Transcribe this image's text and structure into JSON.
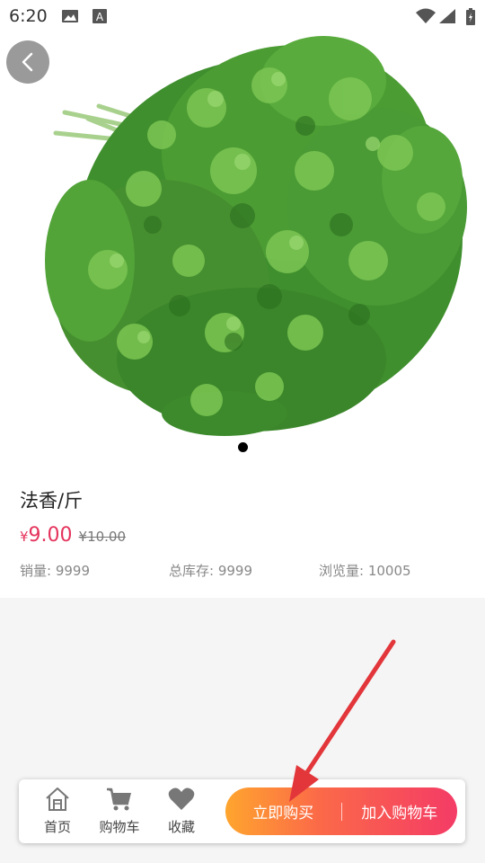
{
  "status_bar": {
    "time": "6:20"
  },
  "product": {
    "title": "法香/斤",
    "price_symbol": "¥",
    "price": "9.00",
    "original_price": "¥10.00",
    "sales": "销量: 9999",
    "stock": "总库存: 9999",
    "views": "浏览量: 10005"
  },
  "bottom_bar": {
    "home_label": "首页",
    "cart_label": "购物车",
    "favorite_label": "收藏",
    "buy_now_label": "立即购买",
    "add_to_cart_label": "加入购物车"
  },
  "colors": {
    "accent": "#e5345d",
    "gradient_start": "#ffa52e",
    "gradient_end": "#f43b66",
    "arrow": "#e2363b"
  }
}
